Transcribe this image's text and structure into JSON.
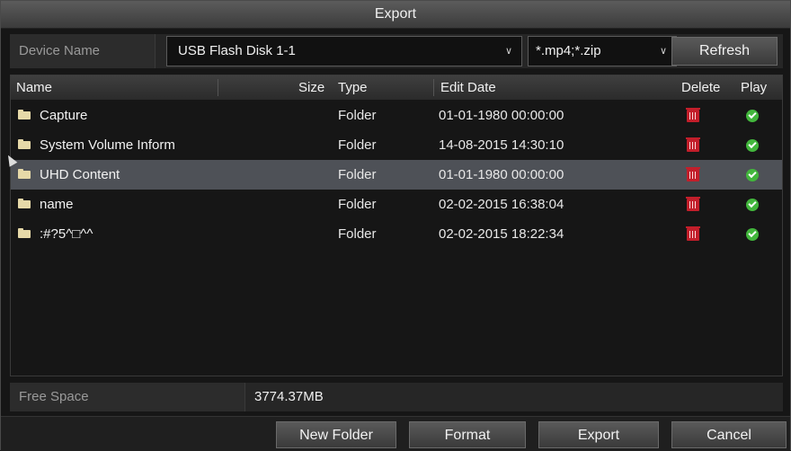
{
  "window": {
    "title": "Export"
  },
  "device": {
    "label": "Device Name",
    "selected": "USB Flash Disk 1-1",
    "filter": "*.mp4;*.zip",
    "refresh_label": "Refresh"
  },
  "table": {
    "headers": {
      "name": "Name",
      "size": "Size",
      "type": "Type",
      "edit_date": "Edit Date",
      "delete": "Delete",
      "play": "Play"
    },
    "rows": [
      {
        "name": "Capture",
        "type": "Folder",
        "edit_date": "01-01-1980 00:00:00",
        "selected": false
      },
      {
        "name": "System Volume Inform",
        "type": "Folder",
        "edit_date": "14-08-2015 14:30:10",
        "selected": false
      },
      {
        "name": "UHD Content",
        "type": "Folder",
        "edit_date": "01-01-1980 00:00:00",
        "selected": true
      },
      {
        "name": "name",
        "type": "Folder",
        "edit_date": "02-02-2015 16:38:04",
        "selected": false
      },
      {
        "name": ":#?5^□^^",
        "type": "Folder",
        "edit_date": "02-02-2015 18:22:34",
        "selected": false
      }
    ],
    "icons": {
      "folder": "folder-icon",
      "delete": "trash-icon",
      "play": "play-check-icon"
    },
    "colors": {
      "selected_row": "#4e5157",
      "delete": "#c21e2a",
      "play": "#42b63c"
    }
  },
  "free_space": {
    "label": "Free Space",
    "value": "3774.37MB"
  },
  "buttons": {
    "new_folder": "New Folder",
    "format": "Format",
    "export": "Export",
    "cancel": "Cancel"
  }
}
